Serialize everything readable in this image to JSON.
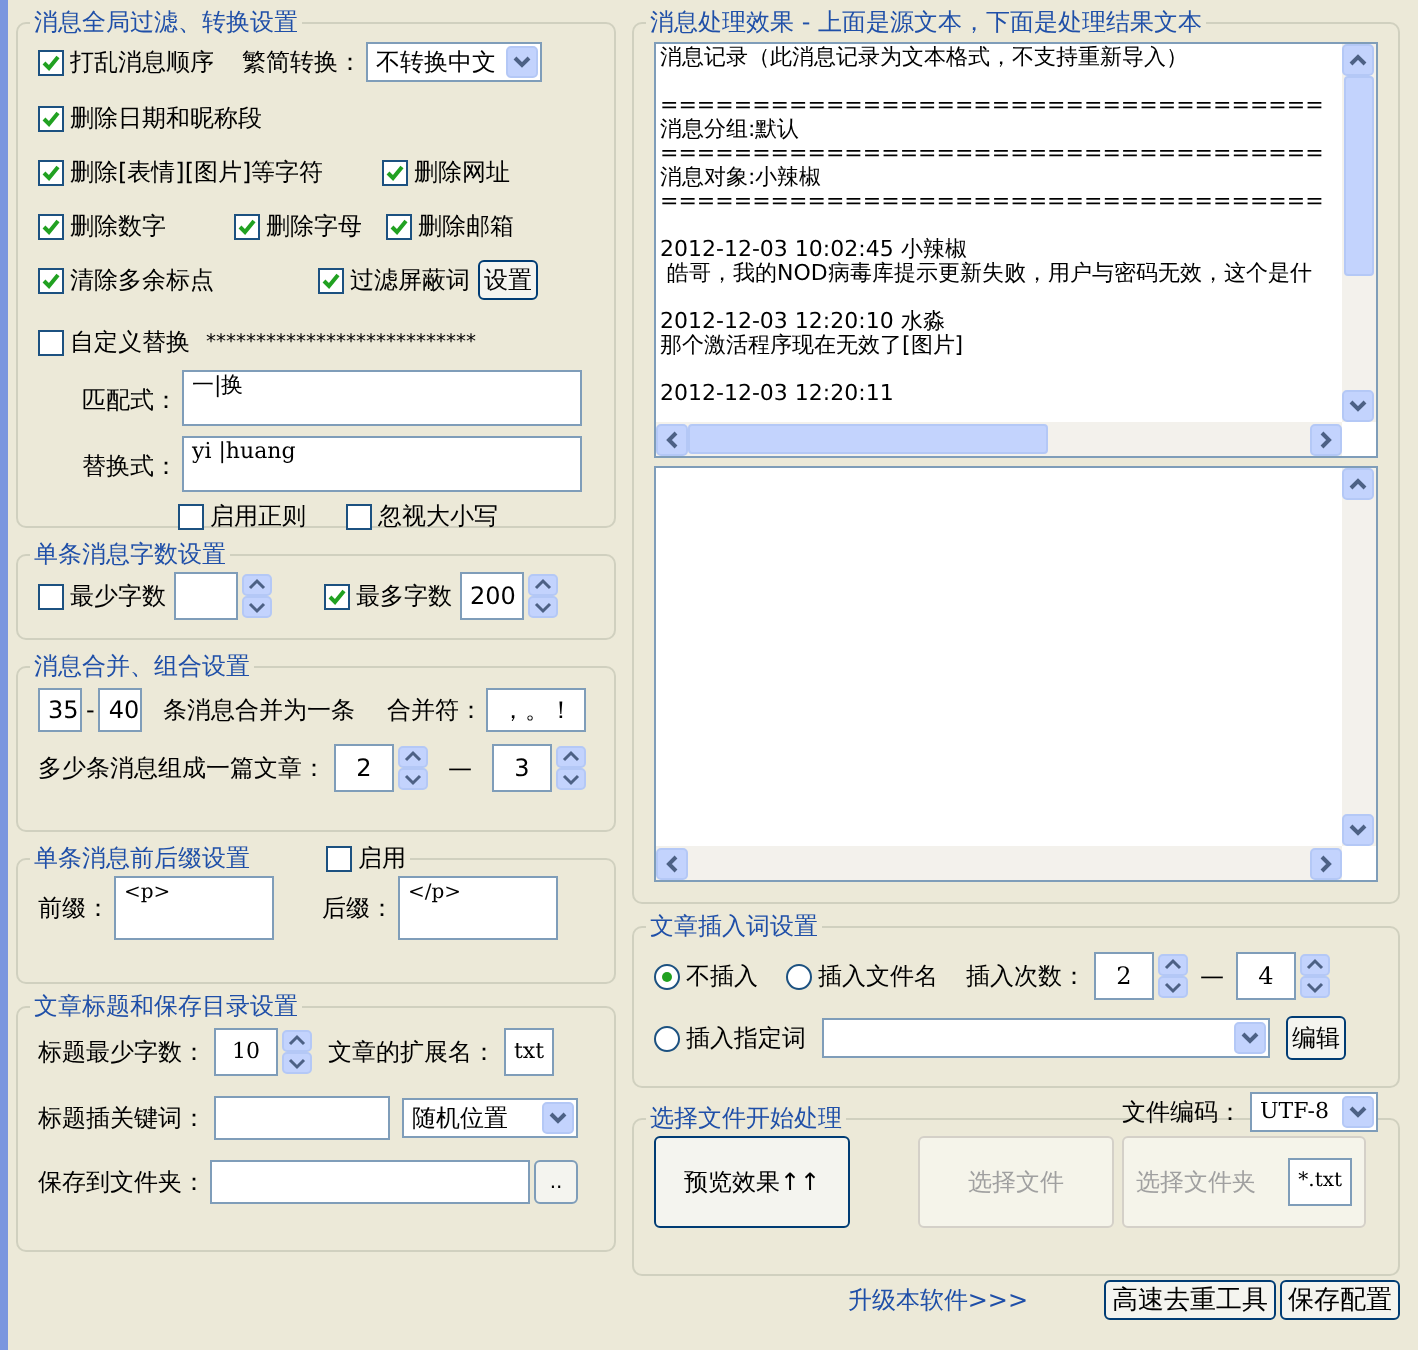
{
  "filter": {
    "title": "消息全局过滤、转换设置",
    "shuffle": {
      "label": "打乱消息顺序",
      "checked": true
    },
    "convert": {
      "label": "繁简转换：",
      "value": "不转换中文"
    },
    "rows": [
      [
        {
          "label": "删除日期和昵称段",
          "checked": true
        }
      ],
      [
        {
          "label": "删除[表情][图片]等字符",
          "checked": true
        },
        {
          "label": "删除网址",
          "checked": true
        }
      ],
      [
        {
          "label": "删除数字",
          "checked": true
        },
        {
          "label": "删除字母",
          "checked": true
        },
        {
          "label": "删除邮箱",
          "checked": true
        }
      ],
      [
        {
          "label": "清除多余标点",
          "checked": true
        },
        {
          "label": "过滤屏蔽词",
          "checked": true
        }
      ]
    ],
    "settings_button": "设置",
    "custom": {
      "label": "自定义替换",
      "checked": false,
      "mask_text": "***************************"
    },
    "match": {
      "label": "匹配式：",
      "value": "一|换"
    },
    "replace": {
      "label": "替换式：",
      "value": "yi |huang"
    },
    "regex": {
      "label": "启用正则",
      "checked": false
    },
    "ignore_case": {
      "label": "忽视大小写",
      "checked": false
    }
  },
  "length": {
    "title": "单条消息字数设置",
    "min": {
      "label": "最少字数",
      "checked": false
    },
    "max": {
      "label": "最多字数",
      "checked": true,
      "value": "200"
    }
  },
  "merge": {
    "title": "消息合并、组合设置",
    "from": "35",
    "dash": "-",
    "to": "40",
    "label": "条消息合并为一条",
    "sep_label": "合并符：",
    "sep_value": "，。！",
    "group_label": "多少条消息组成一篇文章：",
    "group_from": "2",
    "group_dash": "—",
    "group_to": "3"
  },
  "affix": {
    "title": "单条消息前后缀设置",
    "enable": {
      "label": "启用",
      "checked": false
    },
    "prefix_label": "前缀：",
    "prefix": "<p>",
    "suffix_label": "后缀：",
    "suffix": "</p>"
  },
  "article": {
    "title": "文章标题和保存目录设置",
    "min_label": "标题最少字数：",
    "min": "10",
    "ext_label": "文章的扩展名：",
    "ext": "txt",
    "kw_label": "标题插关键词：",
    "position": "随机位置",
    "folder_label": "保存到文件夹：",
    "browse": ".."
  },
  "preview": {
    "title": "消息处理效果 - 上面是源文本，下面是处理结果文本",
    "blocks": [
      [
        "消息记录（此消息记录为文本格式，不支持重新导入）"
      ],
      [
        "====================================",
        "消息分组:默认",
        "====================================",
        "消息对象:小辣椒",
        "===================================="
      ],
      [
        "2012-12-03 10:02:45 小辣椒",
        " 皓哥，我的NOD病毒库提示更新失败，用户与密码无效，这个是什"
      ],
      [
        "2012-12-03 12:20:10 水淼",
        "那个激活程序现在无效了[图片]"
      ],
      [
        "2012-12-03 12:20:11"
      ]
    ]
  },
  "insert": {
    "title": "文章插入词设置",
    "modes": [
      {
        "label": "不插入",
        "selected": true
      },
      {
        "label": "插入文件名",
        "selected": false
      },
      {
        "label": "插入指定词",
        "selected": false
      }
    ],
    "count_label": "插入次数：",
    "count_from": "2",
    "count_dash": "—",
    "count_to": "4",
    "edit_button": "编辑"
  },
  "process": {
    "title": "选择文件开始处理",
    "encoding_label": "文件编码：",
    "encoding": "UTF-8",
    "preview_button": "预览效果↑↑",
    "file_button": {
      "label": "选择文件",
      "disabled": true
    },
    "folder_button": {
      "label": "选择文件夹",
      "disabled": true
    },
    "pattern": "*.txt"
  },
  "footer": {
    "upgrade": "升级本软件>>>",
    "buttons": [
      "高速去重工具",
      "保存配置"
    ]
  }
}
